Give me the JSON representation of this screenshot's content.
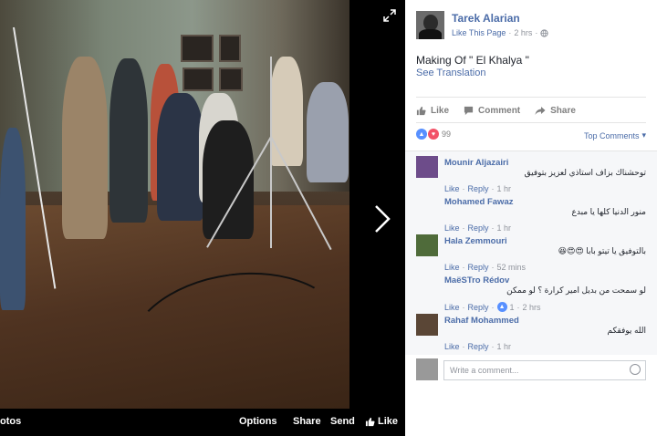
{
  "photo_bar": {
    "photos_label": "otos",
    "options_label": "Options",
    "share_label": "Share",
    "send_label": "Send",
    "like_label": "Like"
  },
  "post": {
    "author": "Tarek Alarian",
    "like_page_label": "Like This Page",
    "time": "2 hrs",
    "text": "Making Of \" El Khalya \"",
    "see_translation": "See Translation"
  },
  "actions": {
    "like": "Like",
    "comment": "Comment",
    "share": "Share"
  },
  "reactions": {
    "count": "99",
    "top_comments": "Top Comments"
  },
  "comments": [
    {
      "author": "Mounir Aljazairi",
      "text": "توحشناك بزاف استاذي لعزيز بتوفيق",
      "like": "Like",
      "reply": "Reply",
      "time": "1 hr",
      "like_count": ""
    },
    {
      "author": "Mohamed Fawaz",
      "text": "منور الدنيا كلها يا مبدع",
      "like": "Like",
      "reply": "Reply",
      "time": "1 hr",
      "like_count": ""
    },
    {
      "author": "Hala Zemmouri",
      "text": "بالتوفيق يا تيتو بابا 😍😍😆",
      "like": "Like",
      "reply": "Reply",
      "time": "52 mins",
      "like_count": ""
    },
    {
      "author": "MaëSTro Rédov",
      "text": "لو سمحت من بديل امير كرارة ؟ لو ممكن",
      "like": "Like",
      "reply": "Reply",
      "time": "2 hrs",
      "like_count": "1"
    },
    {
      "author": "Rahaf Mohammed",
      "text": "الله يوفقكم",
      "like": "Like",
      "reply": "Reply",
      "time": "1 hr",
      "like_count": ""
    }
  ],
  "write_comment": {
    "placeholder": "Write a comment..."
  },
  "colors": {
    "link": "#4b6ca8",
    "like_blue": "#5890ff",
    "love_red": "#f25268"
  }
}
